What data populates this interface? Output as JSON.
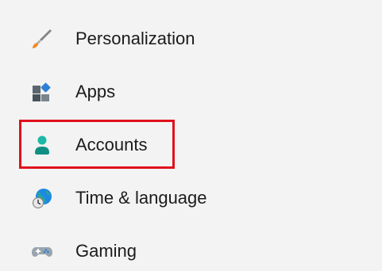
{
  "nav": {
    "items": [
      {
        "label": "Personalization",
        "icon": "paintbrush-icon"
      },
      {
        "label": "Apps",
        "icon": "apps-icon"
      },
      {
        "label": "Accounts",
        "icon": "person-icon"
      },
      {
        "label": "Time & language",
        "icon": "globe-clock-icon"
      },
      {
        "label": "Gaming",
        "icon": "gamepad-icon"
      }
    ]
  },
  "highlight": {
    "target": "Accounts",
    "color": "#e0101b"
  },
  "colors": {
    "background": "#f3f3f3",
    "text": "#1b1b1b",
    "accounts_icon": "#17a89a"
  }
}
